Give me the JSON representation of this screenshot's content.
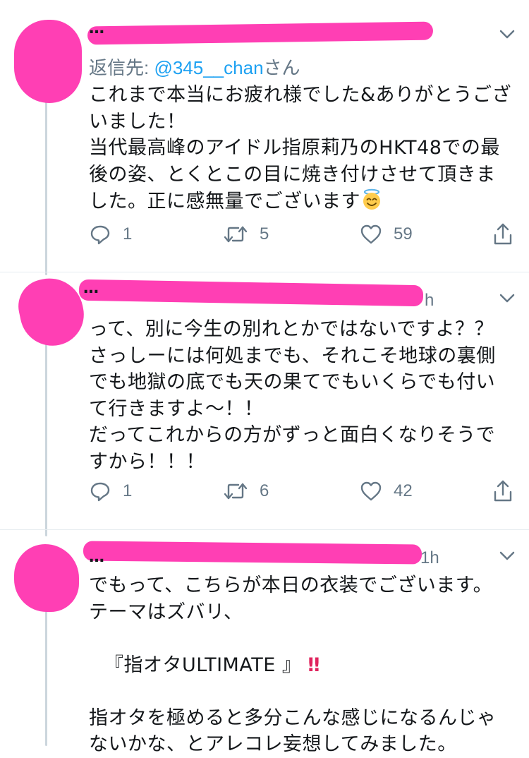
{
  "tweets": [
    {
      "name": "…",
      "reply_to_prefix": "返信先: ",
      "reply_to_handle": "@345__chan",
      "reply_to_suffix": "さん",
      "text_lines": [
        "これまで本当にお疲れ様でした&ありがとうござ",
        "いました！",
        "当代最高峰のアイドル指原莉乃のHKT48での最",
        "後の姿、とくとこの目に焼き付けさせて頂きま",
        "した。正に感無量でございます"
      ],
      "emoji": "smiling-face-with-halo",
      "replies": "1",
      "retweets": "5",
      "likes": "59"
    },
    {
      "name": "…",
      "time": "h",
      "text_lines": [
        "って、別に今生の別れとかではないですよ？？",
        "さっしーには何処までも、それこそ地球の裏側",
        "でも地獄の底でも天の果てでもいくらでも付い",
        "て行きますよ〜！！",
        "だってこれからの方がずっと面白くなりそうで",
        "すから！！！"
      ],
      "replies": "1",
      "retweets": "6",
      "likes": "42"
    },
    {
      "name": "…",
      "time": "1h",
      "text_lines": [
        "でもって、こちらが本日の衣装でございます。",
        "テーマはズバリ、"
      ],
      "quote": "『指オタULTIMATE 』",
      "quote_bangs": "‼",
      "text_lines_2": [
        "指オタを極めると多分こんな感じになるんじゃ",
        "ないかな、とアレコレ妄想してみました。"
      ]
    }
  ],
  "colors": {
    "redaction": "#ff3fb4",
    "link": "#1da1f2",
    "muted": "#657786",
    "thread_line": "#ccd6dd"
  }
}
